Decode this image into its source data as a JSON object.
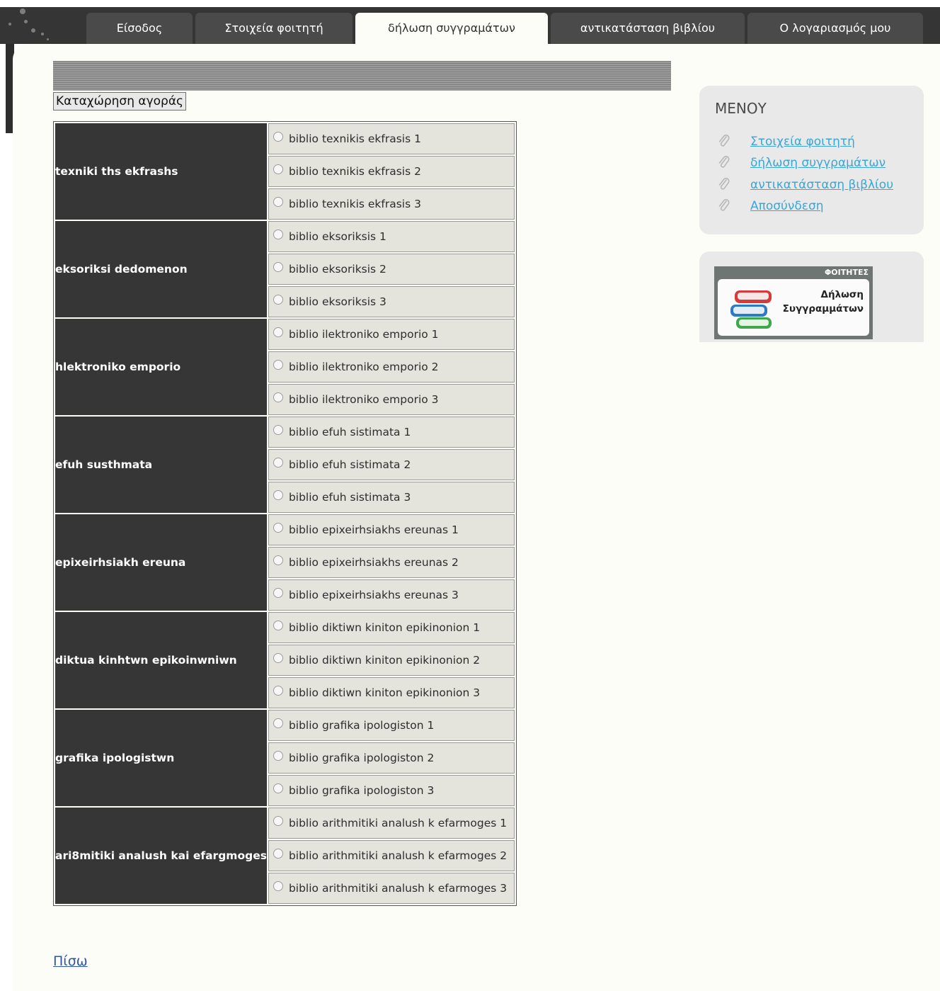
{
  "tabs": [
    {
      "label": "Είσοδος",
      "active": false
    },
    {
      "label": "Στοιχεία φοιτητή",
      "active": false
    },
    {
      "label": "δήλωση συγγραμάτων",
      "active": true
    },
    {
      "label": "αντικατάσταση βιβλίου",
      "active": false
    },
    {
      "label": "Ο λογαριασμός μου",
      "active": false
    }
  ],
  "form": {
    "submit_label": "Καταχώρηση αγοράς"
  },
  "courses": [
    {
      "name": "texniki ths ekfrashs",
      "books": [
        "biblio texnikis ekfrasis 1",
        "biblio texnikis ekfrasis 2",
        "biblio texnikis ekfrasis 3"
      ]
    },
    {
      "name": "eksoriksi dedomenon",
      "books": [
        "biblio eksoriksis 1",
        "biblio eksoriksis 2",
        "biblio eksoriksis 3"
      ]
    },
    {
      "name": "hlektroniko emporio",
      "books": [
        "biblio ilektroniko emporio 1",
        "biblio ilektroniko emporio 2",
        "biblio ilektroniko emporio 3"
      ]
    },
    {
      "name": "efuh susthmata",
      "books": [
        "biblio efuh sistimata 1",
        "biblio efuh sistimata 2",
        "biblio efuh sistimata 3"
      ]
    },
    {
      "name": "epixeirhsiakh ereuna",
      "books": [
        "biblio epixeirhsiakhs ereunas 1",
        "biblio epixeirhsiakhs ereunas 2",
        "biblio epixeirhsiakhs ereunas 3"
      ]
    },
    {
      "name": "diktua kinhtwn epikoinwniwn",
      "books": [
        "biblio diktiwn kiniton epikinonion 1",
        "biblio diktiwn kiniton epikinonion 2",
        "biblio diktiwn kiniton epikinonion 3"
      ]
    },
    {
      "name": "grafika ipologistwn",
      "books": [
        "biblio grafika ipologiston 1",
        "biblio grafika ipologiston 2",
        "biblio grafika ipologiston 3"
      ]
    },
    {
      "name": "ari8mitiki analush kai efargmoges",
      "books": [
        "biblio arithmitiki analush k efarmoges 1",
        "biblio arithmitiki analush k efarmoges 2",
        "biblio arithmitiki analush k efarmoges 3"
      ]
    }
  ],
  "back_link": "Πίσω",
  "sidebar": {
    "menu_title": "ΜΕΝΟΥ",
    "items": [
      {
        "label": "Στοιχεία φοιτητή",
        "icon": "paperclip-icon"
      },
      {
        "label": "δήλωση συγγραμάτων",
        "icon": "paperclip-icon"
      },
      {
        "label": "αντικατάσταση βιβλίου",
        "icon": "paperclip-icon"
      },
      {
        "label": "Αποσύνδεση",
        "icon": "paperclip-icon"
      }
    ],
    "banner": {
      "header": "ΦΟΙΤΗΤΕΣ",
      "line1": "Δήλωση",
      "line2": "Συγγραμμάτων",
      "icon": "books-stack-icon"
    }
  },
  "colors": {
    "header_dark": "#353535",
    "page_bg": "#fcfdf6",
    "course_cell": "#363636",
    "book_cell": "#e4e3dc",
    "link": "#3aa6d6"
  }
}
